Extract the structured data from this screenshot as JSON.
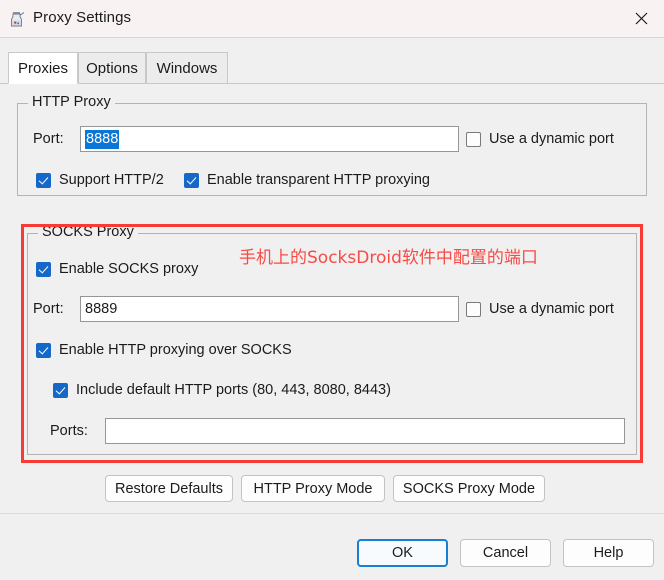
{
  "window": {
    "title": "Proxy Settings",
    "app_icon": "charles-proxy-icon",
    "close_label": "✕"
  },
  "tabs": [
    {
      "label": "Proxies",
      "active": true
    },
    {
      "label": "Options",
      "active": false
    },
    {
      "label": "Windows",
      "active": false
    }
  ],
  "http_proxy": {
    "legend": "HTTP Proxy",
    "port_label": "Port:",
    "port_value": "8888",
    "port_selected": true,
    "dynamic_port_label": "Use a dynamic port",
    "dynamic_port_checked": false,
    "support_http2_label": "Support HTTP/2",
    "support_http2_checked": true,
    "transparent_label": "Enable transparent HTTP proxying",
    "transparent_checked": true
  },
  "socks_proxy": {
    "legend": "SOCKS Proxy",
    "enable_label": "Enable SOCKS proxy",
    "enable_checked": true,
    "port_label": "Port:",
    "port_value": "8889",
    "dynamic_port_label": "Use a dynamic port",
    "dynamic_port_checked": false,
    "http_over_socks_label": "Enable HTTP proxying over SOCKS",
    "http_over_socks_checked": true,
    "include_default_label": "Include default HTTP ports (80, 443, 8080, 8443)",
    "include_default_checked": true,
    "ports_label": "Ports:",
    "ports_value": "",
    "ports_placeholder": ""
  },
  "annotation": {
    "text": "手机上的SocksDroid软件中配置的端口",
    "color": "#f74b46",
    "box_color": "#f93b36"
  },
  "mode_buttons": [
    {
      "label": "Restore Defaults"
    },
    {
      "label": "HTTP Proxy Mode"
    },
    {
      "label": "SOCKS Proxy Mode"
    }
  ],
  "footer_buttons": [
    {
      "label": "OK",
      "primary": true
    },
    {
      "label": "Cancel",
      "primary": false
    },
    {
      "label": "Help",
      "primary": false
    }
  ],
  "colors": {
    "titlebar": "#f9f2f2",
    "body": "#f0f0f0",
    "checkbox_on": "#1668c8",
    "selection": "#0a76d8",
    "focus_border": "#1a7fd4"
  }
}
